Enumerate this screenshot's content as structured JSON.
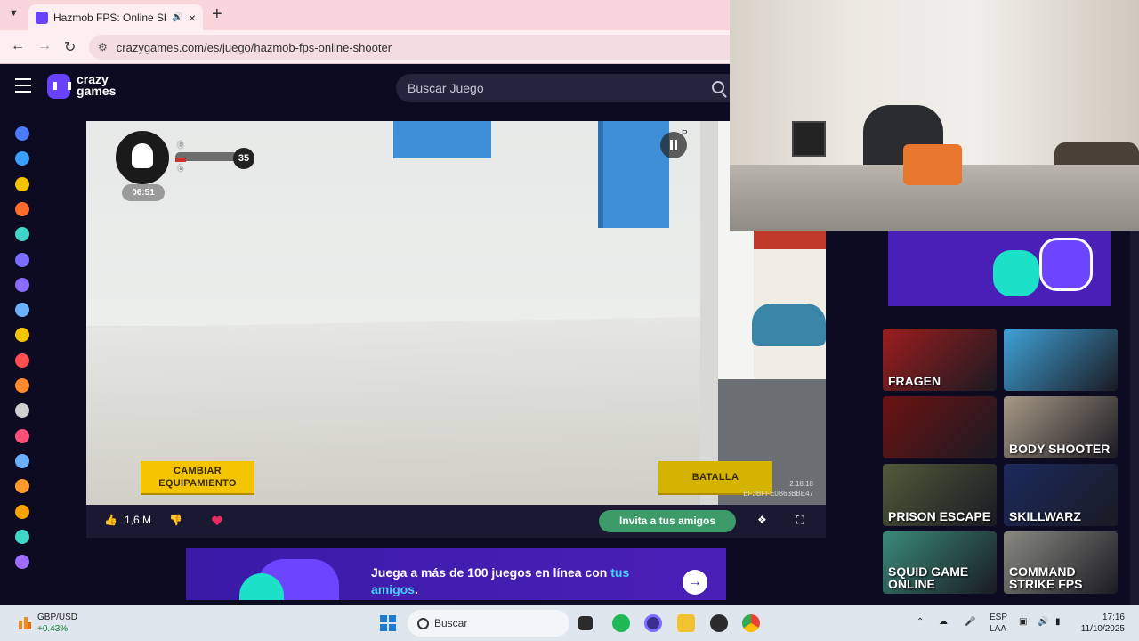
{
  "browser": {
    "tab_title": "Hazmob FPS: Online Shooter",
    "tab_menu_icon": "chevron-down-icon",
    "new_tab_label": "+",
    "url": "crazygames.com/es/juego/hazmob-fps-online-shooter"
  },
  "site": {
    "logo_line1": "crazy",
    "logo_line2": "games",
    "search_placeholder": "Buscar Juego",
    "accent_color": "#6842ff",
    "rail_icons": [
      "home-icon",
      "recent-icon",
      "new-icon",
      "trending-icon",
      "updated-icon",
      "originals-icon",
      "multiplayer-icon",
      "two-player-icon",
      "action-icon",
      "adventure-icon",
      "basketball-icon",
      "billiards-icon",
      "card-icon",
      "clicker-icon",
      "shooting-icon",
      "car-icon",
      "soccer-icon",
      "controller-icon"
    ]
  },
  "game": {
    "hud": {
      "kills": "0",
      "deaths": "6",
      "score": "35",
      "timer": "06:51"
    },
    "pause_key": "P",
    "equip_button": "CAMBIAR EQUIPAMIENTO",
    "battle_button": "BATALLA",
    "version": "2.18.18",
    "build_id": "EF3BFFE0B63BBE47"
  },
  "gamebar": {
    "likes": "1,6 M",
    "invite_button": "Invita a tus amigos"
  },
  "banner": {
    "text_main": "Juega a más de 100 juegos en línea con ",
    "text_highlight": "tus",
    "text_line2": "amigos",
    "text_end": "."
  },
  "sidebar_games": [
    {
      "title": "FRAGEN",
      "color": "#9c1d1d"
    },
    {
      "title": "",
      "color": "#3fa2d8"
    },
    {
      "title": "",
      "color": "#6d1212"
    },
    {
      "title": "BODY SHOOTER",
      "color": "#a89a86"
    },
    {
      "title": "PRISON ESCAPE",
      "color": "#4f5b3a"
    },
    {
      "title": "SKILLWARZ",
      "color": "#1b2a5e"
    },
    {
      "title": "SQUID GAME ONLINE",
      "color": "#3a8a7a"
    },
    {
      "title": "COMMAND STRIKE FPS",
      "color": "#8a8a82"
    }
  ],
  "taskbar": {
    "stock_name": "GBP/USD",
    "stock_change": "+0.43%",
    "search_label": "Buscar",
    "lang_line1": "ESP",
    "lang_line2": "LAA",
    "time": "17:16",
    "date": "11/10/2025"
  }
}
